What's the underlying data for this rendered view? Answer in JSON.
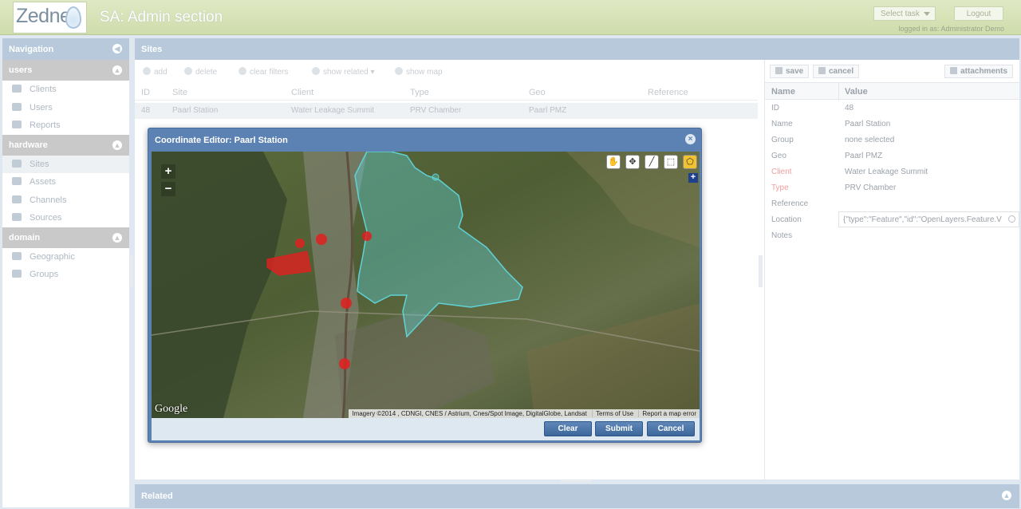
{
  "header": {
    "logo_text": "Zednet",
    "title": "SA: Admin section",
    "select_task": "Select task",
    "logout": "Logout",
    "logged_in": "logged in as: Administrator Demo"
  },
  "nav": {
    "title": "Navigation",
    "groups": [
      {
        "label": "users",
        "items": [
          "Clients",
          "Users",
          "Reports"
        ]
      },
      {
        "label": "hardware",
        "items": [
          "Sites",
          "Assets",
          "Channels",
          "Sources"
        ]
      },
      {
        "label": "domain",
        "items": [
          "Geographic",
          "Groups"
        ]
      }
    ]
  },
  "sites": {
    "title": "Sites",
    "toolbar": {
      "add": "add",
      "delete": "delete",
      "clear_filters": "clear filters",
      "show_related": "show related",
      "show_map": "show map"
    },
    "columns": [
      "ID",
      "Site",
      "Client",
      "Type",
      "Geo",
      "Reference"
    ],
    "row": {
      "id": "48",
      "site": "Paarl Station",
      "client": "Water Leakage Summit",
      "type": "PRV Chamber",
      "geo": "Paarl PMZ",
      "reference": ""
    }
  },
  "details": {
    "save": "save",
    "cancel": "cancel",
    "attachments": "attachments",
    "head_name": "Name",
    "head_value": "Value",
    "props": [
      {
        "label": "ID",
        "value": "48",
        "required": false
      },
      {
        "label": "Name",
        "value": "Paarl Station",
        "required": false
      },
      {
        "label": "Group",
        "value": "none selected",
        "required": false
      },
      {
        "label": "Geo",
        "value": "Paarl PMZ",
        "required": false
      },
      {
        "label": "Client",
        "value": "Water Leakage Summit",
        "required": true
      },
      {
        "label": "Type",
        "value": "PRV Chamber",
        "required": true
      },
      {
        "label": "Reference",
        "value": "",
        "required": false
      }
    ],
    "location_label": "Location",
    "location_value": "{\"type\":\"Feature\",\"id\":\"OpenLayers.Feature.V",
    "notes_label": "Notes"
  },
  "related": {
    "title": "Related"
  },
  "modal": {
    "title": "Coordinate Editor: Paarl Station",
    "google": "Google",
    "attribution": "Imagery ©2014 , CDNGI, CNES / Astrium, Cnes/Spot Image, DigitalGlobe, Landsat",
    "terms": "Terms of Use",
    "report": "Report a map error",
    "clear": "Clear",
    "submit": "Submit",
    "cancel": "Cancel"
  },
  "colors": {
    "header_bg": "#d8e4b8",
    "panel_header": "#b7c9da",
    "button_blue": "#4d76a8",
    "polygon_cyan": "#5fd3d6",
    "marker_red": "#e02020"
  }
}
